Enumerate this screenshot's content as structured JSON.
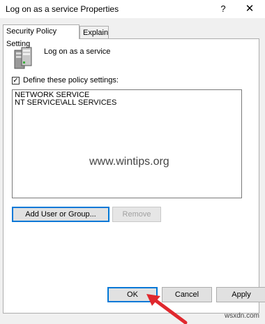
{
  "window": {
    "title": "Log on as a service Properties",
    "help_label": "?",
    "close_label": "✕"
  },
  "tabs": [
    {
      "label": "Security Policy Setting",
      "active": true
    },
    {
      "label": "Explain",
      "active": false
    }
  ],
  "policy": {
    "name": "Log on as a service",
    "icon": "server-policy-icon"
  },
  "define_checkbox": {
    "label": "Define these policy settings:",
    "checked": true,
    "mark": "✓"
  },
  "accounts": [
    "NETWORK SERVICE",
    "NT SERVICE\\ALL SERVICES"
  ],
  "watermark": "www.wintips.org",
  "buttons": {
    "add": "Add User or Group...",
    "remove": "Remove",
    "ok": "OK",
    "cancel": "Cancel",
    "apply": "Apply"
  },
  "site_mark": "wsxdn.com",
  "colors": {
    "accent": "#0078d7",
    "arrow": "#e0282e"
  }
}
